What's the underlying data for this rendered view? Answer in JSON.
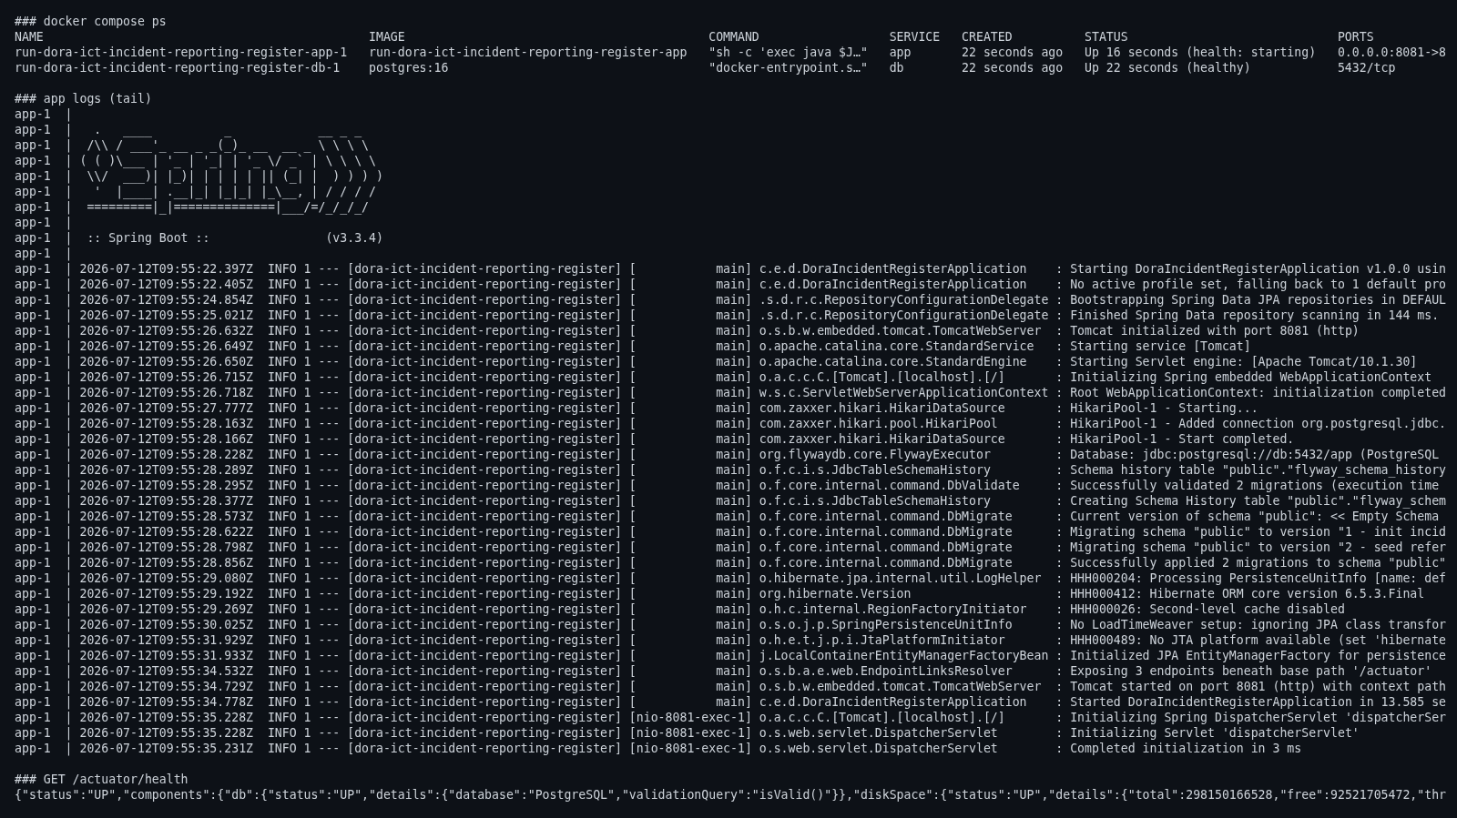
{
  "sections": [
    {
      "kind": "table",
      "heading": "### docker compose ps",
      "columns": [
        "NAME",
        "IMAGE",
        "COMMAND",
        "SERVICE",
        "CREATED",
        "STATUS",
        "PORTS"
      ],
      "rows": [
        [
          "run-dora-ict-incident-reporting-register-app-1",
          "run-dora-ict-incident-reporting-register-app",
          "\"sh -c 'exec java $J…\"",
          "app",
          "22 seconds ago",
          "Up 16 seconds (health: starting)",
          "0.0.0.0:8081->8"
        ],
        [
          "run-dora-ict-incident-reporting-register-db-1",
          "postgres:16",
          "\"docker-entrypoint.s…\"",
          "db",
          "22 seconds ago",
          "Up 22 seconds (healthy)",
          "5432/tcp"
        ]
      ]
    },
    {
      "kind": "log",
      "heading": "### app logs (tail)",
      "lines": [
        "app-1  |",
        "app-1  |   .   ____          _            __ _ _",
        "app-1  |  /\\\\ / ___'_ __ _ _(_)_ __  __ _ \\ \\ \\ \\",
        "app-1  | ( ( )\\___ | '_ | '_| | '_ \\/ _` | \\ \\ \\ \\",
        "app-1  |  \\\\/  ___)| |_)| | | | | || (_| |  ) ) ) )",
        "app-1  |   '  |____| .__|_| |_|_| |_\\__, | / / / /",
        "app-1  |  =========|_|==============|___/=/_/_/_/",
        "app-1  |",
        "app-1  |  :: Spring Boot ::                (v3.3.4)",
        "app-1  |",
        "app-1  | 2026-07-12T09:55:22.397Z  INFO 1 --- [dora-ict-incident-reporting-register] [           main] c.e.d.DoraIncidentRegisterApplication    : Starting DoraIncidentRegisterApplication v1.0.0 usin",
        "app-1  | 2026-07-12T09:55:22.405Z  INFO 1 --- [dora-ict-incident-reporting-register] [           main] c.e.d.DoraIncidentRegisterApplication    : No active profile set, falling back to 1 default pro",
        "app-1  | 2026-07-12T09:55:24.854Z  INFO 1 --- [dora-ict-incident-reporting-register] [           main] .s.d.r.c.RepositoryConfigurationDelegate : Bootstrapping Spring Data JPA repositories in DEFAUL",
        "app-1  | 2026-07-12T09:55:25.021Z  INFO 1 --- [dora-ict-incident-reporting-register] [           main] .s.d.r.c.RepositoryConfigurationDelegate : Finished Spring Data repository scanning in 144 ms.",
        "app-1  | 2026-07-12T09:55:26.632Z  INFO 1 --- [dora-ict-incident-reporting-register] [           main] o.s.b.w.embedded.tomcat.TomcatWebServer  : Tomcat initialized with port 8081 (http)",
        "app-1  | 2026-07-12T09:55:26.649Z  INFO 1 --- [dora-ict-incident-reporting-register] [           main] o.apache.catalina.core.StandardService   : Starting service [Tomcat]",
        "app-1  | 2026-07-12T09:55:26.650Z  INFO 1 --- [dora-ict-incident-reporting-register] [           main] o.apache.catalina.core.StandardEngine    : Starting Servlet engine: [Apache Tomcat/10.1.30]",
        "app-1  | 2026-07-12T09:55:26.715Z  INFO 1 --- [dora-ict-incident-reporting-register] [           main] o.a.c.c.C.[Tomcat].[localhost].[/]       : Initializing Spring embedded WebApplicationContext",
        "app-1  | 2026-07-12T09:55:26.718Z  INFO 1 --- [dora-ict-incident-reporting-register] [           main] w.s.c.ServletWebServerApplicationContext : Root WebApplicationContext: initialization completed",
        "app-1  | 2026-07-12T09:55:27.777Z  INFO 1 --- [dora-ict-incident-reporting-register] [           main] com.zaxxer.hikari.HikariDataSource       : HikariPool-1 - Starting...",
        "app-1  | 2026-07-12T09:55:28.163Z  INFO 1 --- [dora-ict-incident-reporting-register] [           main] com.zaxxer.hikari.pool.HikariPool        : HikariPool-1 - Added connection org.postgresql.jdbc.",
        "app-1  | 2026-07-12T09:55:28.166Z  INFO 1 --- [dora-ict-incident-reporting-register] [           main] com.zaxxer.hikari.HikariDataSource       : HikariPool-1 - Start completed.",
        "app-1  | 2026-07-12T09:55:28.228Z  INFO 1 --- [dora-ict-incident-reporting-register] [           main] org.flywaydb.core.FlywayExecutor         : Database: jdbc:postgresql://db:5432/app (PostgreSQL",
        "app-1  | 2026-07-12T09:55:28.289Z  INFO 1 --- [dora-ict-incident-reporting-register] [           main] o.f.c.i.s.JdbcTableSchemaHistory         : Schema history table \"public\".\"flyway_schema_history",
        "app-1  | 2026-07-12T09:55:28.295Z  INFO 1 --- [dora-ict-incident-reporting-register] [           main] o.f.core.internal.command.DbValidate     : Successfully validated 2 migrations (execution time",
        "app-1  | 2026-07-12T09:55:28.377Z  INFO 1 --- [dora-ict-incident-reporting-register] [           main] o.f.c.i.s.JdbcTableSchemaHistory         : Creating Schema History table \"public\".\"flyway_schem",
        "app-1  | 2026-07-12T09:55:28.573Z  INFO 1 --- [dora-ict-incident-reporting-register] [           main] o.f.core.internal.command.DbMigrate      : Current version of schema \"public\": << Empty Schema",
        "app-1  | 2026-07-12T09:55:28.622Z  INFO 1 --- [dora-ict-incident-reporting-register] [           main] o.f.core.internal.command.DbMigrate      : Migrating schema \"public\" to version \"1 - init incid",
        "app-1  | 2026-07-12T09:55:28.798Z  INFO 1 --- [dora-ict-incident-reporting-register] [           main] o.f.core.internal.command.DbMigrate      : Migrating schema \"public\" to version \"2 - seed refer",
        "app-1  | 2026-07-12T09:55:28.856Z  INFO 1 --- [dora-ict-incident-reporting-register] [           main] o.f.core.internal.command.DbMigrate      : Successfully applied 2 migrations to schema \"public\"",
        "app-1  | 2026-07-12T09:55:29.080Z  INFO 1 --- [dora-ict-incident-reporting-register] [           main] o.hibernate.jpa.internal.util.LogHelper  : HHH000204: Processing PersistenceUnitInfo [name: def",
        "app-1  | 2026-07-12T09:55:29.192Z  INFO 1 --- [dora-ict-incident-reporting-register] [           main] org.hibernate.Version                    : HHH000412: Hibernate ORM core version 6.5.3.Final",
        "app-1  | 2026-07-12T09:55:29.269Z  INFO 1 --- [dora-ict-incident-reporting-register] [           main] o.h.c.internal.RegionFactoryInitiator    : HHH000026: Second-level cache disabled",
        "app-1  | 2026-07-12T09:55:30.025Z  INFO 1 --- [dora-ict-incident-reporting-register] [           main] o.s.o.j.p.SpringPersistenceUnitInfo      : No LoadTimeWeaver setup: ignoring JPA class transfor",
        "app-1  | 2026-07-12T09:55:31.929Z  INFO 1 --- [dora-ict-incident-reporting-register] [           main] o.h.e.t.j.p.i.JtaPlatformInitiator       : HHH000489: No JTA platform available (set 'hibernate",
        "app-1  | 2026-07-12T09:55:31.933Z  INFO 1 --- [dora-ict-incident-reporting-register] [           main] j.LocalContainerEntityManagerFactoryBean : Initialized JPA EntityManagerFactory for persistence",
        "app-1  | 2026-07-12T09:55:34.532Z  INFO 1 --- [dora-ict-incident-reporting-register] [           main] o.s.b.a.e.web.EndpointLinksResolver      : Exposing 3 endpoints beneath base path '/actuator'",
        "app-1  | 2026-07-12T09:55:34.729Z  INFO 1 --- [dora-ict-incident-reporting-register] [           main] o.s.b.w.embedded.tomcat.TomcatWebServer  : Tomcat started on port 8081 (http) with context path",
        "app-1  | 2026-07-12T09:55:34.778Z  INFO 1 --- [dora-ict-incident-reporting-register] [           main] c.e.d.DoraIncidentRegisterApplication    : Started DoraIncidentRegisterApplication in 13.585 se",
        "app-1  | 2026-07-12T09:55:35.228Z  INFO 1 --- [dora-ict-incident-reporting-register] [nio-8081-exec-1] o.a.c.c.C.[Tomcat].[localhost].[/]       : Initializing Spring DispatcherServlet 'dispatcherSer",
        "app-1  | 2026-07-12T09:55:35.228Z  INFO 1 --- [dora-ict-incident-reporting-register] [nio-8081-exec-1] o.s.web.servlet.DispatcherServlet        : Initializing Servlet 'dispatcherServlet'",
        "app-1  | 2026-07-12T09:55:35.231Z  INFO 1 --- [dora-ict-incident-reporting-register] [nio-8081-exec-1] o.s.web.servlet.DispatcherServlet        : Completed initialization in 3 ms"
      ]
    },
    {
      "kind": "output",
      "heading": "### GET /actuator/health",
      "lines": [
        "{\"status\":\"UP\",\"components\":{\"db\":{\"status\":\"UP\",\"details\":{\"database\":\"PostgreSQL\",\"validationQuery\":\"isValid()\"}},\"diskSpace\":{\"status\":\"UP\",\"details\":{\"total\":298150166528,\"free\":92521705472,\"thr"
      ]
    }
  ]
}
